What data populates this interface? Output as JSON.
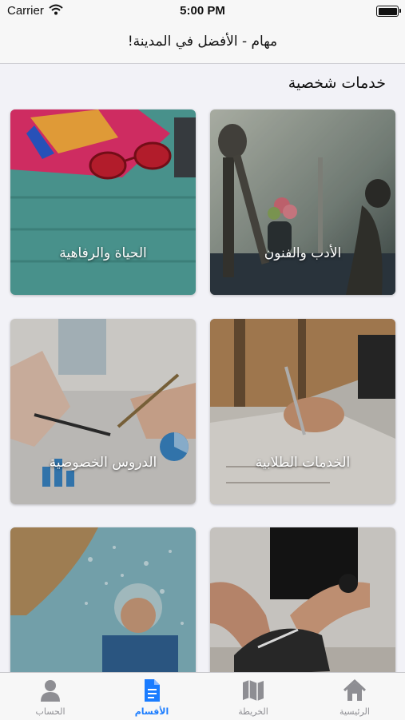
{
  "status_bar": {
    "carrier": "Carrier",
    "time": "5:00 PM"
  },
  "nav": {
    "title": "مهام - الأفضل في المدينة!"
  },
  "section": {
    "title": "خدمات شخصية"
  },
  "categories": [
    {
      "label": "الأدب والفنون",
      "image": "sculptures-photo"
    },
    {
      "label": "الحياة والرفاهية",
      "image": "sunglasses-towel-photo"
    },
    {
      "label": "الخدمات الطلابية",
      "image": "writing-notebook-photo"
    },
    {
      "label": "الدروس الخصوصية",
      "image": "charts-pens-photo"
    },
    {
      "label": "",
      "image": "shoelace-photo"
    },
    {
      "label": "",
      "image": "shower-man-photo"
    }
  ],
  "tabs": [
    {
      "label": "الرئيسية",
      "icon": "home-icon",
      "active": false
    },
    {
      "label": "الخريطة",
      "icon": "map-icon",
      "active": false
    },
    {
      "label": "الأقسام",
      "icon": "document-icon",
      "active": true
    },
    {
      "label": "الحساب",
      "icon": "person-icon",
      "active": false
    }
  ],
  "colors": {
    "accent": "#1a7cff",
    "inactive_tab": "#8e8e93",
    "background": "#f2f2f7"
  }
}
